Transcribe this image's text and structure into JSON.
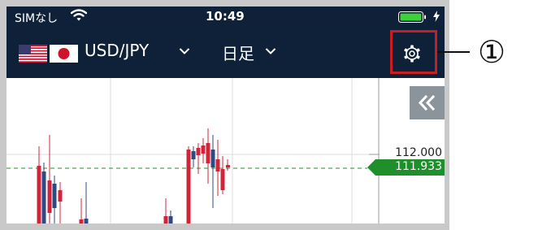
{
  "status_bar": {
    "carrier": "SIMなし",
    "time": "10:49",
    "icons": [
      "wifi-icon",
      "battery-icon",
      "charging-bolt-icon"
    ],
    "battery_color": "#3dd13a"
  },
  "header": {
    "flags": [
      "us-flag-icon",
      "jp-flag-icon"
    ],
    "pair_label": "USD/JPY",
    "timeframe_label": "日足",
    "settings_icon": "gear-icon",
    "background_color": "#0e2138"
  },
  "annotation": {
    "marker": "①",
    "highlight_color": "#c81e22"
  },
  "chart": {
    "collapse_icon": "double-chevron-left-icon",
    "price_tick": "112.000",
    "current_price": "111.933",
    "current_price_color": "#1f8f2c",
    "up_color": "#d0243a",
    "down_color": "#2c4a86",
    "gridline_color": "#dddddd"
  }
}
